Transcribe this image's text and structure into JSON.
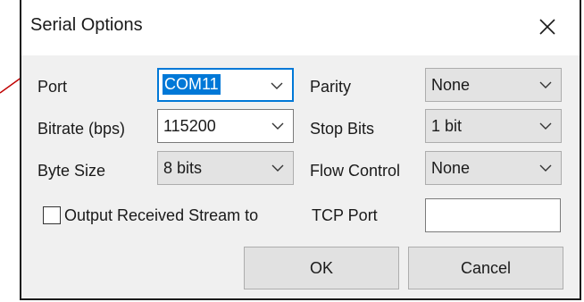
{
  "window": {
    "title": "Serial Options",
    "close_glyph": "✕"
  },
  "fields": {
    "port": {
      "label": "Port",
      "value": "COM11"
    },
    "bitrate": {
      "label": "Bitrate (bps)",
      "value": "115200"
    },
    "byte_size": {
      "label": "Byte Size",
      "value": "8 bits"
    },
    "parity": {
      "label": "Parity",
      "value": "None"
    },
    "stop_bits": {
      "label": "Stop Bits",
      "value": "1 bit"
    },
    "flow_control": {
      "label": "Flow Control",
      "value": "None"
    }
  },
  "output": {
    "checkbox_label": "Output Received Stream to",
    "checked": false,
    "tcp_label": "TCP Port",
    "tcp_value": ""
  },
  "buttons": {
    "ok": "OK",
    "cancel": "Cancel"
  },
  "colors": {
    "accent": "#0078d7",
    "client_bg": "#f0f0f0",
    "annotation": "#c00000"
  },
  "icons": {
    "close": "close-icon",
    "dropdown": "chevron-down-icon"
  }
}
